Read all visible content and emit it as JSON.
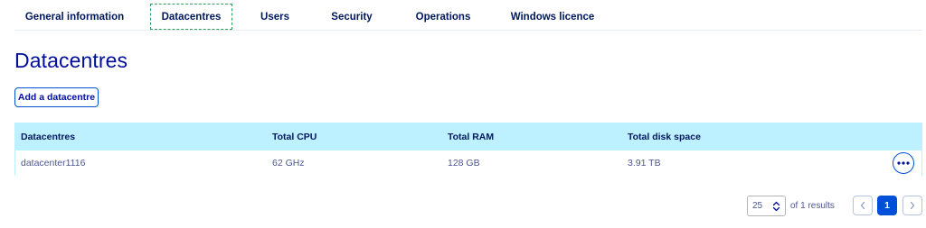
{
  "tabs": [
    {
      "label": "General information",
      "active": false
    },
    {
      "label": "Datacentres",
      "active": true
    },
    {
      "label": "Users",
      "active": false
    },
    {
      "label": "Security",
      "active": false
    },
    {
      "label": "Operations",
      "active": false
    },
    {
      "label": "Windows licence",
      "active": false
    }
  ],
  "heading": {
    "title": "Datacentres",
    "add_button_label": "Add a datacentre"
  },
  "table": {
    "columns": [
      "Datacentres",
      "Total CPU",
      "Total RAM",
      "Total disk space"
    ],
    "rows": [
      {
        "name": "datacenter1116",
        "cpu": "62 GHz",
        "ram": "128 GB",
        "disk": "3.91 TB",
        "actions_icon": "ellipsis-icon"
      }
    ]
  },
  "pagination": {
    "page_size": "25",
    "results_text": "of 1 results",
    "current_page": "1",
    "prev_icon": "chevron-left-icon",
    "next_icon": "chevron-right-icon",
    "page_size_icon": "up-down-caret-icon"
  },
  "colors": {
    "primary": "#0050d7",
    "heading_text": "#000e9c",
    "table_header_bg": "#bef1ff",
    "body_text": "#4d5693",
    "active_tab_outline": "#2f9e5a"
  }
}
